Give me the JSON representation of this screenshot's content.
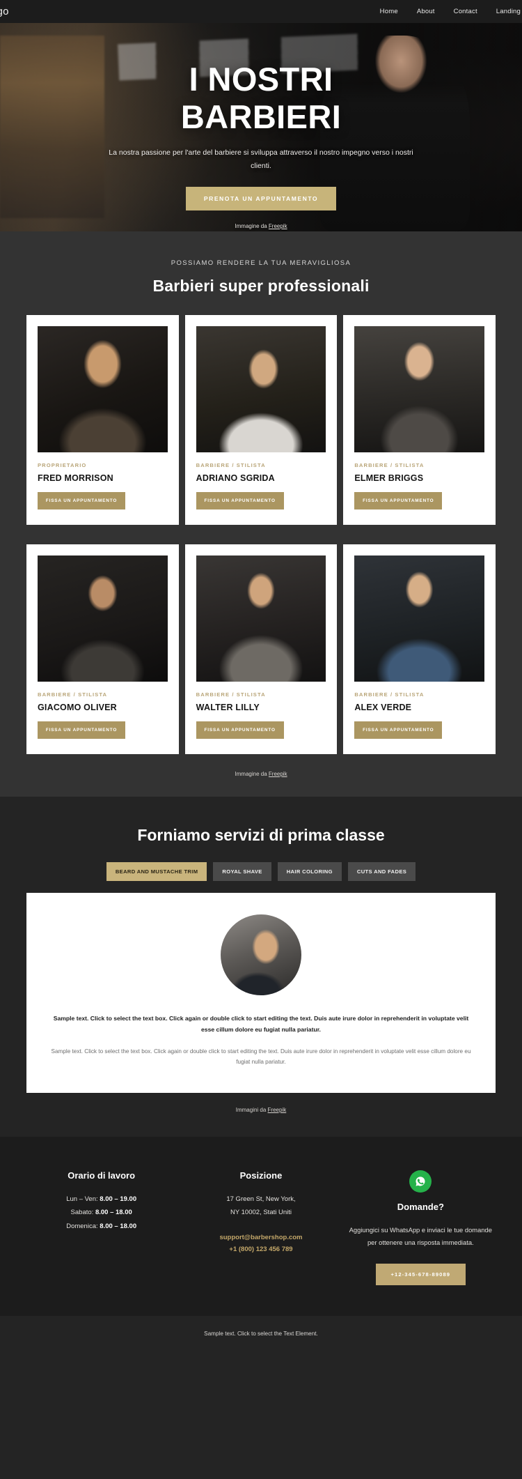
{
  "header": {
    "logo": "ogo",
    "nav": [
      {
        "label": "Home"
      },
      {
        "label": "About"
      },
      {
        "label": "Contact"
      },
      {
        "label": "Landing"
      }
    ]
  },
  "hero": {
    "title_line1": "I NOSTRI",
    "title_line2": "BARBIERI",
    "subtitle": "La nostra passione per l'arte del barbiere si sviluppa attraverso il nostro impegno verso i nostri clienti.",
    "cta": "PRENOTA UN APPUNTAMENTO",
    "credit_prefix": "Immagine da ",
    "credit_link": "Freepik"
  },
  "team": {
    "eyebrow": "POSSIAMO RENDERE LA TUA MERAVIGLIOSA",
    "title": "Barbieri super professionali",
    "cta_label": "FISSA UN APPUNTAMENTO",
    "members": [
      {
        "role": "PROPRIETARIO",
        "name": "FRED MORRISON"
      },
      {
        "role": "BARBIERE / STILISTA",
        "name": "ADRIANO SGRIDA"
      },
      {
        "role": "BARBIERE / STILISTA",
        "name": "ELMER BRIGGS"
      },
      {
        "role": "BARBIERE / STILISTA",
        "name": "GIACOMO OLIVER"
      },
      {
        "role": "BARBIERE / STILISTA",
        "name": "WALTER LILLY"
      },
      {
        "role": "BARBIERE / STILISTA",
        "name": "ALEX VERDE"
      }
    ],
    "credit_prefix": "Immagine da ",
    "credit_link": "Freepik"
  },
  "services": {
    "title": "Forniamo servizi di prima classe",
    "tabs": [
      {
        "label": "BEARD AND MUSTACHE TRIM",
        "active": true
      },
      {
        "label": "ROYAL SHAVE",
        "active": false
      },
      {
        "label": "HAIR COLORING",
        "active": false
      },
      {
        "label": "CUTS AND FADES",
        "active": false
      }
    ],
    "panel_lead": "Sample text. Click to select the text box. Click again or double click to start editing the text. Duis aute irure dolor in reprehenderit in voluptate velit esse cillum dolore eu fugiat nulla pariatur.",
    "panel_body": "Sample text. Click to select the text box. Click again or double click to start editing the text. Duis aute irure dolor in reprehenderit in voluptate velit esse cillum dolore eu fugiat nulla pariatur.",
    "credit_prefix": "Immagini da ",
    "credit_link": "Freepik"
  },
  "footer": {
    "hours": {
      "title": "Orario di lavoro",
      "rows": [
        {
          "label": "Lun – Ven: ",
          "value": "8.00 – 19.00"
        },
        {
          "label": "Sabato: ",
          "value": "8.00 – 18.00"
        },
        {
          "label": "Domenica: ",
          "value": "8.00 – 18.00"
        }
      ]
    },
    "location": {
      "title": "Posizione",
      "address_line1": "17 Green St, New York,",
      "address_line2": "NY 10002, Stati Uniti",
      "email": "support@barbershop.com",
      "phone": "+1 (800) 123 456 789"
    },
    "questions": {
      "icon": "whatsapp-icon",
      "title": "Domande?",
      "text": "Aggiungici su WhatsApp e inviaci le tue domande per ottenere una risposta immediata.",
      "button": "+12-345-678-89089"
    },
    "bottom_note": "Sample text. Click to select the Text Element."
  },
  "colors": {
    "gold": "#c7b47a",
    "card_gold": "#ab9661",
    "whatsapp_green": "#25b24a",
    "dark_bg": "#242424",
    "team_bg": "#333333"
  }
}
